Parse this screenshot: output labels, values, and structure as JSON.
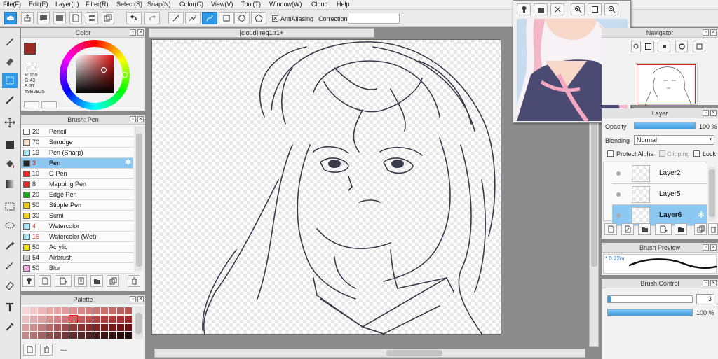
{
  "menu": [
    "File(F)",
    "Edit(E)",
    "Layer(L)",
    "Filter(R)",
    "Select(S)",
    "Snap(N)",
    "Color(C)",
    "View(V)",
    "Tool(T)",
    "Window(W)",
    "Cloud",
    "Help"
  ],
  "toolbar": {
    "antialiasing_label": "AntiAliasing",
    "correction_label": "Correction",
    "correction_value": ""
  },
  "canvas_tab": "[cloud] req1:r1+",
  "color_panel": {
    "title": "Color",
    "r": "R:155",
    "g": "G:43",
    "b": "B:37",
    "hex": "#9B2B25",
    "main_color": "#9b2b25"
  },
  "brush_panel": {
    "title": "Brush: Pen",
    "items": [
      {
        "size": "20",
        "name": "Pencil",
        "color": "#ffffff",
        "size_color": "#222222"
      },
      {
        "size": "70",
        "name": "Smudge",
        "color": "#fbe0c8",
        "size_color": "#222222"
      },
      {
        "size": "19",
        "name": "Pen (Sharp)",
        "color": "#a8e4f4",
        "size_color": "#222222"
      },
      {
        "size": "3",
        "name": "Pen",
        "color": "#222222",
        "size_color": "#d83030"
      },
      {
        "size": "10",
        "name": "G Pen",
        "color": "#e02a2a",
        "size_color": "#222222"
      },
      {
        "size": "8",
        "name": "Mapping Pen",
        "color": "#e02a2a",
        "size_color": "#222222"
      },
      {
        "size": "20",
        "name": "Edge Pen",
        "color": "#1faa1f",
        "size_color": "#222222"
      },
      {
        "size": "50",
        "name": "Stipple Pen",
        "color": "#f0d020",
        "size_color": "#222222"
      },
      {
        "size": "30",
        "name": "Sumi",
        "color": "#f0d020",
        "size_color": "#222222"
      },
      {
        "size": "4",
        "name": "Watercolor",
        "color": "#a8e4f4",
        "size_color": "#d83030"
      },
      {
        "size": "16",
        "name": "Watercolor (Wet)",
        "color": "#a8e4f4",
        "size_color": "#d83030"
      },
      {
        "size": "50",
        "name": "Acrylic",
        "color": "#f0e020",
        "size_color": "#222222"
      },
      {
        "size": "54",
        "name": "Airbrush",
        "color": "#c8c8c8",
        "size_color": "#222222"
      },
      {
        "size": "50",
        "name": "Blur",
        "color": "#f4a8e0",
        "size_color": "#222222"
      }
    ],
    "selected_index": 3
  },
  "palette": {
    "title": "Palette",
    "footer": "---"
  },
  "navigator": {
    "title": "Navigator"
  },
  "layer_panel": {
    "title": "Layer",
    "opacity_label": "Opacity",
    "opacity_value": "100 %",
    "opacity_fraction": 1.0,
    "blending_label": "Blending",
    "blending_value": "Normal",
    "protect_alpha": "Protect Alpha",
    "clipping": "Clipping",
    "lock": "Lock",
    "layers": [
      {
        "name": "Layer2"
      },
      {
        "name": "Layer5"
      },
      {
        "name": "Layer6"
      }
    ],
    "selected_index": 2
  },
  "brush_preview": {
    "title": "Brush Preview",
    "size": "* 0.22m"
  },
  "brush_control": {
    "title": "Brush Control",
    "size_value": "3",
    "size_fraction": 0.03,
    "density_value": "100 %",
    "density_fraction": 1.0
  }
}
